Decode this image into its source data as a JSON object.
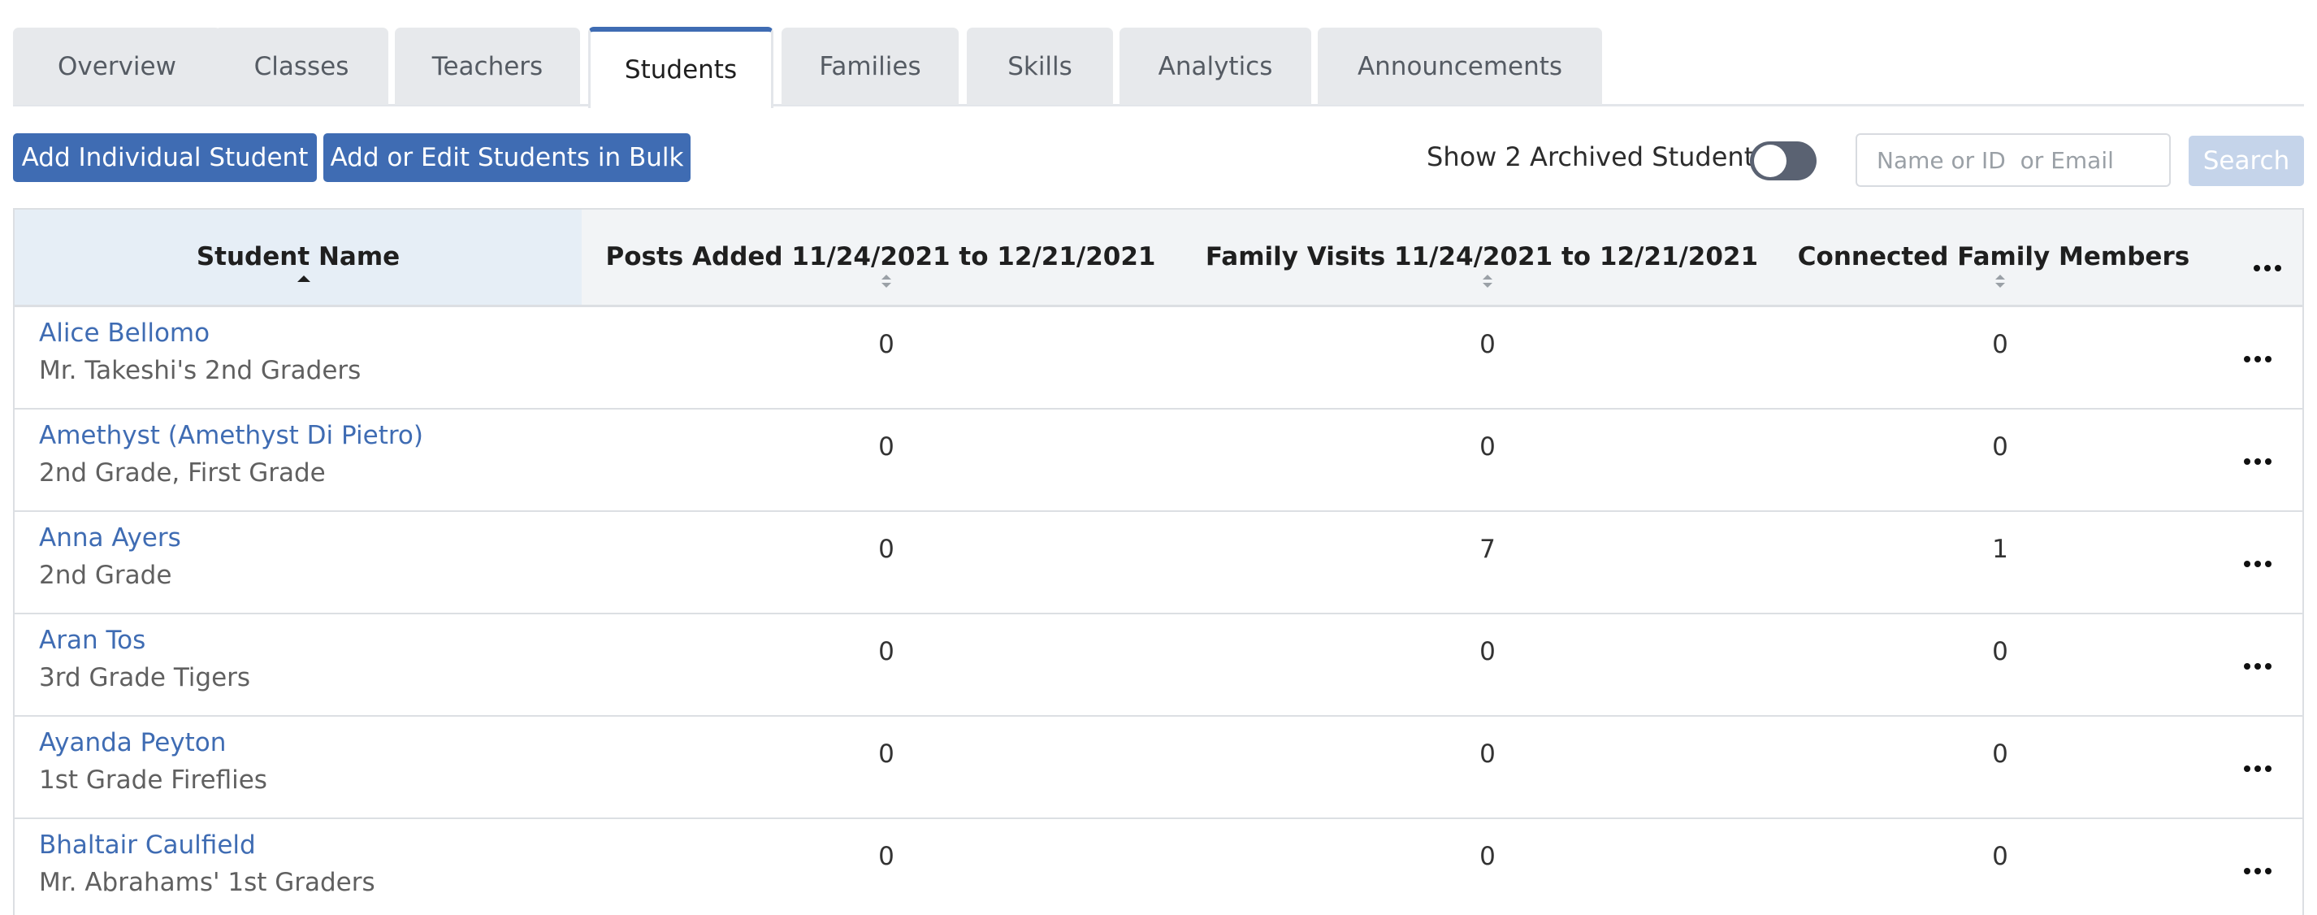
{
  "tabs": [
    {
      "label": "Overview"
    },
    {
      "label": "Classes"
    },
    {
      "label": "Teachers"
    },
    {
      "label": "Students",
      "active": true
    },
    {
      "label": "Families"
    },
    {
      "label": "Skills"
    },
    {
      "label": "Analytics"
    },
    {
      "label": "Announcements"
    }
  ],
  "toolbar": {
    "add_individual_label": "Add Individual Student",
    "add_bulk_label": "Add or Edit Students in Bulk",
    "archived_label": "Show 2 Archived Students",
    "archived_toggle_on": false,
    "search_placeholder": "Name or ID  or Email",
    "search_label": "Search"
  },
  "table": {
    "columns": [
      {
        "label": "Student Name",
        "sort": "ascending"
      },
      {
        "label": "Posts Added 11/24/2021 to 12/21/2021",
        "sort": "none"
      },
      {
        "label": "Family Visits 11/24/2021 to 12/21/2021",
        "sort": "none"
      },
      {
        "label": "Connected Family Members",
        "sort": "none"
      }
    ],
    "rows": [
      {
        "name": "Alice Bellomo",
        "class": "Mr. Takeshi's 2nd Graders",
        "posts": "0",
        "visits": "0",
        "members": "0"
      },
      {
        "name": "Amethyst (Amethyst Di Pietro)",
        "class": "2nd Grade, First Grade",
        "posts": "0",
        "visits": "0",
        "members": "0"
      },
      {
        "name": "Anna Ayers",
        "class": "2nd Grade",
        "posts": "0",
        "visits": "7",
        "members": "1"
      },
      {
        "name": "Aran Tos",
        "class": "3rd Grade Tigers",
        "posts": "0",
        "visits": "0",
        "members": "0"
      },
      {
        "name": "Ayanda Peyton",
        "class": "1st Grade Fireflies",
        "posts": "0",
        "visits": "0",
        "members": "0"
      },
      {
        "name": "Bhaltair Caulfield",
        "class": "Mr. Abrahams' 1st Graders",
        "posts": "0",
        "visits": "0",
        "members": "0"
      }
    ]
  },
  "colors": {
    "accent": "#3f6cb3",
    "link": "#3f6cb3",
    "search_disabled": "#c5d4ea",
    "toggle_off": "#5a6272"
  }
}
